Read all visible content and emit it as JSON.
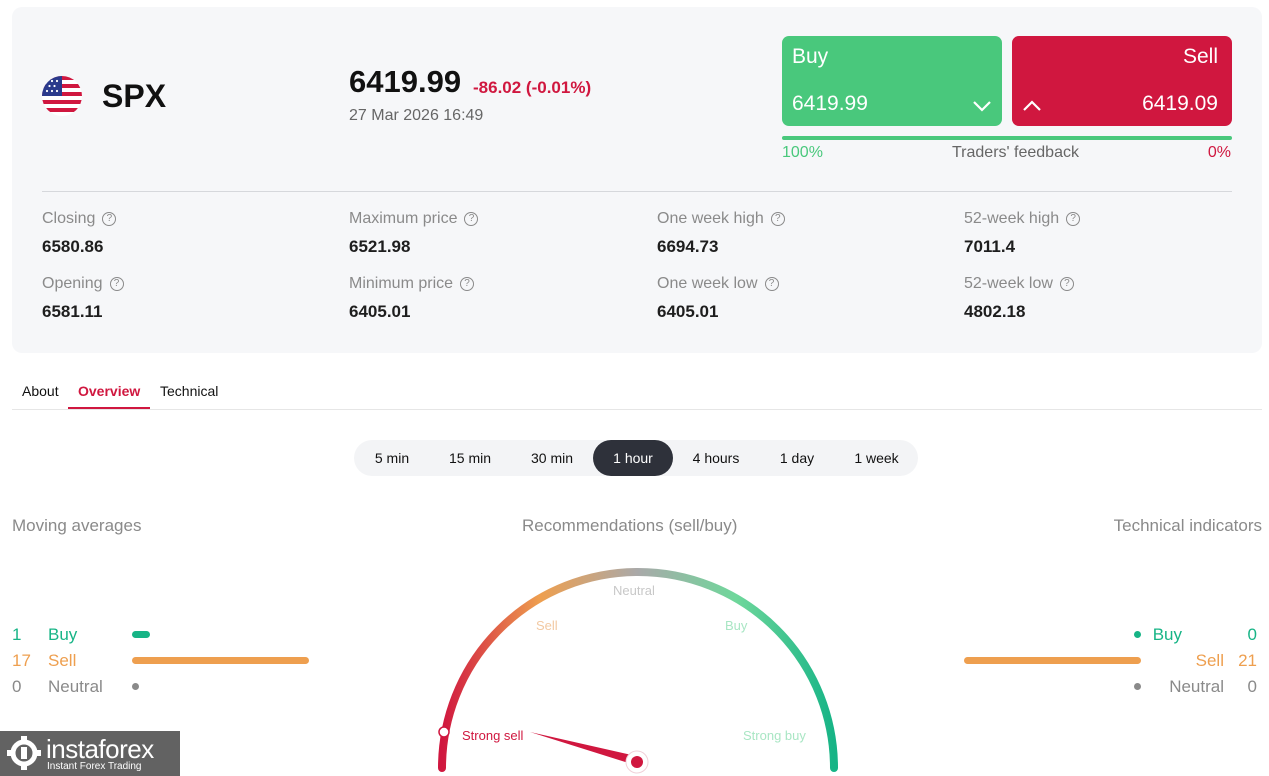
{
  "instrument": {
    "symbol": "SPX",
    "flag_icon": "us-flag-icon",
    "price": "6419.99",
    "change": "-86.02 (-0.01%)",
    "datetime": "27 Mar 2026 16:49"
  },
  "trade": {
    "buy_label": "Buy",
    "buy_value": "6419.99",
    "sell_label": "Sell",
    "sell_value": "6419.09",
    "buy_color": "#49c87c",
    "sell_color": "#d0173f"
  },
  "feedback": {
    "buy_percent_text": "100%",
    "label": "Traders' feedback",
    "sell_percent_text": "0%",
    "buy_fraction": 1.0
  },
  "stats": [
    {
      "label": "Closing",
      "value": "6580.86"
    },
    {
      "label": "Opening",
      "value": "6581.11"
    },
    {
      "label": "Maximum price",
      "value": "6521.98"
    },
    {
      "label": "Minimum price",
      "value": "6405.01"
    },
    {
      "label": "One week high",
      "value": "6694.73"
    },
    {
      "label": "One week low",
      "value": "6405.01"
    },
    {
      "label": "52-week high",
      "value": "7011.4"
    },
    {
      "label": "52-week low",
      "value": "4802.18"
    }
  ],
  "tabs": [
    {
      "label": "About"
    },
    {
      "label": "Overview"
    },
    {
      "label": "Technical"
    }
  ],
  "active_tab": "Overview",
  "periods": [
    {
      "label": "5 min"
    },
    {
      "label": "15 min"
    },
    {
      "label": "30 min"
    },
    {
      "label": "1 hour"
    },
    {
      "label": "4 hours"
    },
    {
      "label": "1 day"
    },
    {
      "label": "1 week"
    }
  ],
  "active_period": "1 hour",
  "sections": {
    "moving_averages": "Moving averages",
    "recommendations": "Recommendations (sell/buy)",
    "technical_indicators": "Technical indicators"
  },
  "moving_averages": [
    {
      "count": "1",
      "label": "Buy",
      "value": 1
    },
    {
      "count": "17",
      "label": "Sell",
      "value": 17
    },
    {
      "count": "0",
      "label": "Neutral",
      "value": 0
    }
  ],
  "technical_indicators": [
    {
      "count": "0",
      "label": "Buy",
      "value": 0
    },
    {
      "count": "21",
      "label": "Sell",
      "value": 21
    },
    {
      "count": "0",
      "label": "Neutral",
      "value": 0
    }
  ],
  "gauge": {
    "labels": {
      "strong_sell": "Strong sell",
      "sell": "Sell",
      "neutral": "Neutral",
      "buy": "Buy",
      "strong_buy": "Strong buy"
    },
    "reading": "Strong sell"
  },
  "colors": {
    "buy": "#17b486",
    "sell": "#ee9f4f",
    "neutral": "#8a8a8a",
    "accent": "#d0173f"
  },
  "watermark": {
    "brand": "instaforex",
    "tagline": "Instant Forex Trading"
  }
}
